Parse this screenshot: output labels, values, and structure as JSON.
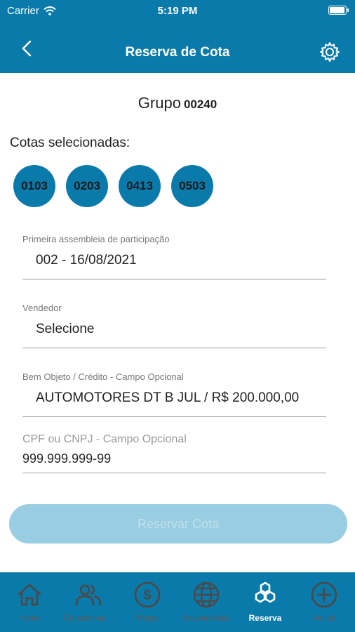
{
  "status_bar": {
    "carrier": "Carrier",
    "time": "5:19 PM"
  },
  "nav": {
    "title": "Reserva de Cota"
  },
  "group": {
    "label": "Grupo",
    "number": "00240"
  },
  "cotas": {
    "label": "Cotas selecionadas:",
    "items": [
      "0103",
      "0203",
      "0413",
      "0503"
    ]
  },
  "fields": {
    "assembleia": {
      "label": "Primeira assembleia de participação",
      "value": "002 - 16/08/2021"
    },
    "vendedor": {
      "label": "Vendedor",
      "value": "Selecione"
    },
    "bem": {
      "label": "Bem Objeto / Crédito - Campo Opcional",
      "value": "AUTOMOTORES DT B JUL / R$ 200.000,00"
    },
    "cpf": {
      "label": "CPF ou CNPJ - Campo Opcional",
      "value": "999.999.999-99"
    }
  },
  "button": {
    "label": "Reservar Cota"
  },
  "tabs": [
    {
      "label": "Home",
      "icon": "home-icon"
    },
    {
      "label": "Consorciad...",
      "icon": "people-icon"
    },
    {
      "label": "Preços",
      "icon": "dollar-icon"
    },
    {
      "label": "Assembleias",
      "icon": "globe-icon"
    },
    {
      "label": "Reserva",
      "icon": "honeycomb-icon",
      "active": true
    },
    {
      "label": "Venda",
      "icon": "plus-circle-icon"
    }
  ],
  "colors": {
    "primary": "#0a7aab",
    "button_disabled": "#99cde1",
    "text": "#222222",
    "muted": "#777777"
  }
}
